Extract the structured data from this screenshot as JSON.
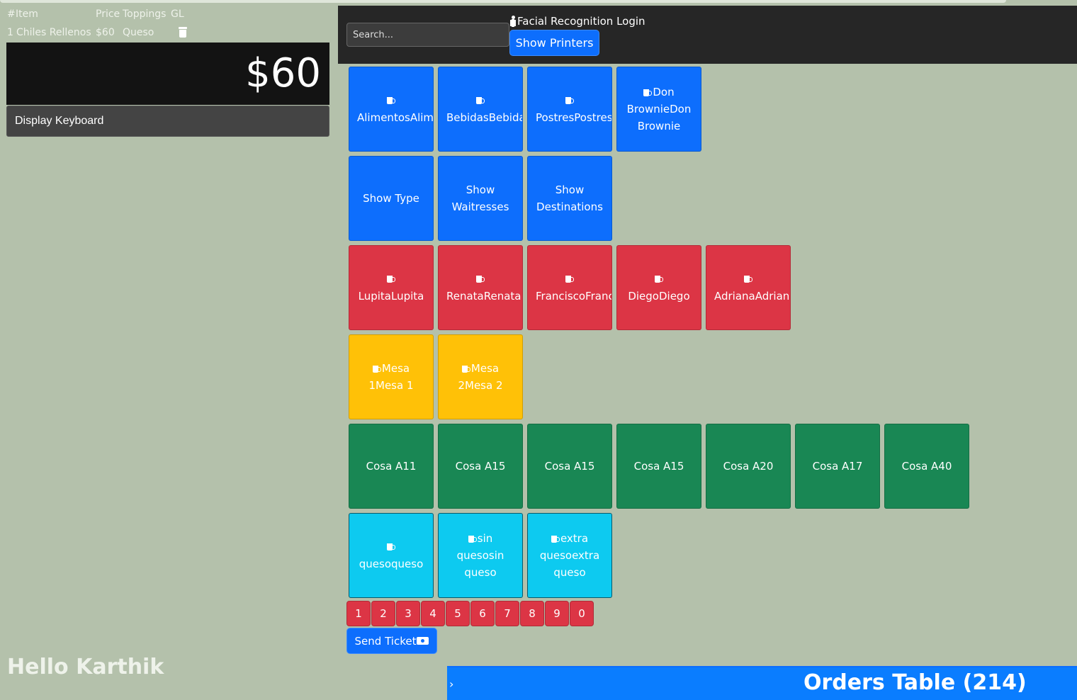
{
  "order": {
    "headers": {
      "num": "#",
      "item": "Item",
      "price": "Price",
      "toppings": "Toppings",
      "gl": "GL"
    },
    "rows": [
      {
        "qty": "1",
        "item": "Chiles Rellenos",
        "price": "$60",
        "toppings": "Queso"
      }
    ],
    "total": "$60",
    "display_keyboard_label": "Display Keyboard"
  },
  "greeting": "Hello Karthik",
  "topbar": {
    "search_placeholder": "Search...",
    "facial_login_label": "Facial Recognition Login",
    "show_printers_label": "Show Printers"
  },
  "tiles": {
    "categories": [
      "AlimentosAlimentos",
      "BebidasBebidas",
      "PostresPostres",
      "Don BrownieDon Brownie"
    ],
    "actions": [
      "Show Type",
      "Show Waitresses",
      "Show Destinations"
    ],
    "waitresses": [
      "LupitaLupita",
      "RenataRenata",
      "FranciscoFrancisco",
      "DiegoDiego",
      "AdrianaAdriana"
    ],
    "tables": [
      "Mesa 1Mesa 1",
      "Mesa 2Mesa 2"
    ],
    "items": [
      "Cosa A11",
      "Cosa A15",
      "Cosa A15",
      "Cosa A15",
      "Cosa A20",
      "Cosa A17",
      "Cosa A40"
    ],
    "toppings": [
      "quesoqueso",
      "sin quesosin queso",
      "extra quesoextra queso"
    ]
  },
  "numpad": [
    "1",
    "2",
    "3",
    "4",
    "5",
    "6",
    "7",
    "8",
    "9",
    "0"
  ],
  "send_ticket_label": "Send Ticket",
  "orders_table": {
    "chevron": "›",
    "title": "Orders Table (214)"
  },
  "colors": {
    "background": "#b4c1ab",
    "primary": "#0d6efd",
    "danger": "#dc3545",
    "warning": "#ffc107",
    "success": "#198754",
    "info": "#0dcaf0",
    "topbar": "#262626"
  },
  "icons": {
    "trash": "trash-icon",
    "person": "person-icon",
    "cup": "cup-icon",
    "ticket": "ticket-icon"
  }
}
